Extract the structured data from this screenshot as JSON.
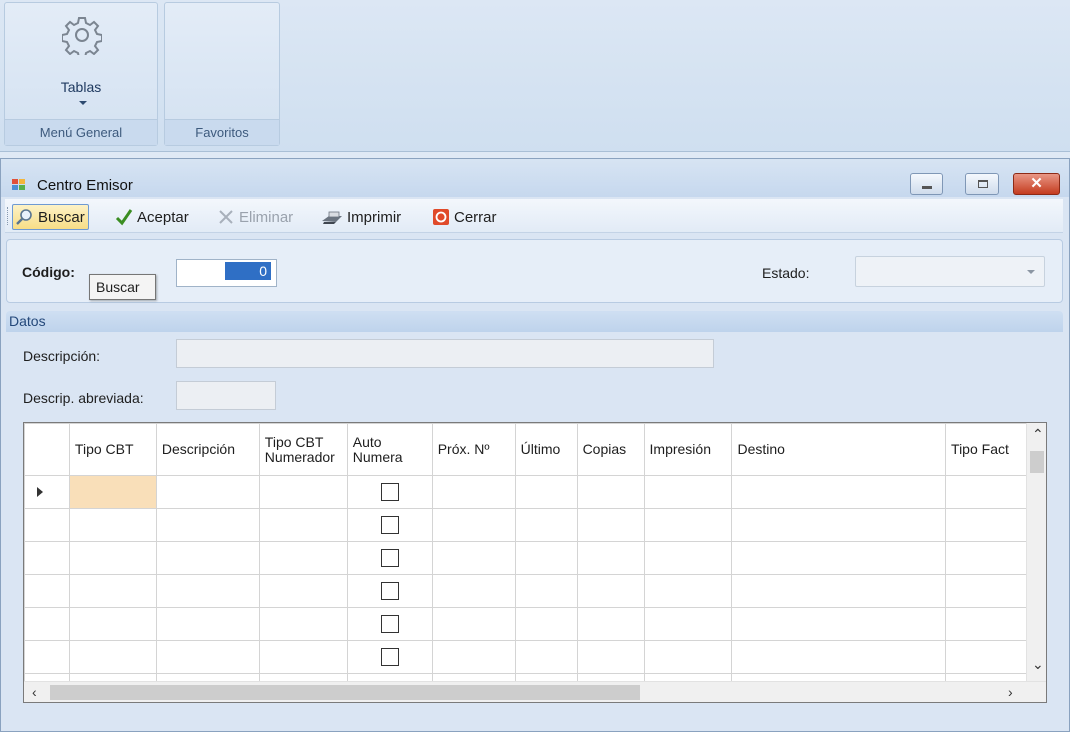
{
  "ribbon": {
    "groups": [
      {
        "label": "Menú General",
        "button_label": "Tablas",
        "button_icon": "gear-icon"
      },
      {
        "label": "Favoritos"
      }
    ]
  },
  "window": {
    "title": "Centro Emisor",
    "controls": [
      "minimize",
      "maximize",
      "close"
    ]
  },
  "toolbar": {
    "buscar": "Buscar",
    "aceptar": "Aceptar",
    "eliminar": "Eliminar",
    "imprimir": "Imprimir",
    "cerrar": "Cerrar"
  },
  "header": {
    "codigo_label": "Código:",
    "codigo_value": "0",
    "tooltip": "Buscar",
    "estado_label": "Estado:",
    "estado_value": ""
  },
  "datos": {
    "section_title": "Datos",
    "descripcion_label": "Descripción:",
    "descripcion_value": "",
    "descrip_abreviada_label": "Descrip. abreviada:",
    "descrip_abreviada_value": ""
  },
  "grid": {
    "columns": [
      {
        "line1": "Tipo CBT",
        "line2": ""
      },
      {
        "line1": "Descripción",
        "line2": ""
      },
      {
        "line1": "Tipo CBT",
        "line2": "Numerador"
      },
      {
        "line1": "Auto",
        "line2": "Numera"
      },
      {
        "line1": "Próx. Nº",
        "line2": ""
      },
      {
        "line1": "Último",
        "line2": ""
      },
      {
        "line1": "Copias",
        "line2": ""
      },
      {
        "line1": "Impresión",
        "line2": ""
      },
      {
        "line1": "Destino",
        "line2": ""
      },
      {
        "line1": "Tipo Fact",
        "line2": ""
      }
    ],
    "visible_rows": 7,
    "selected_row": 0
  },
  "colors": {
    "accent": "#2f6fc5",
    "selected_cell": "#f9dfb9",
    "close_button": "#c43c1f"
  }
}
